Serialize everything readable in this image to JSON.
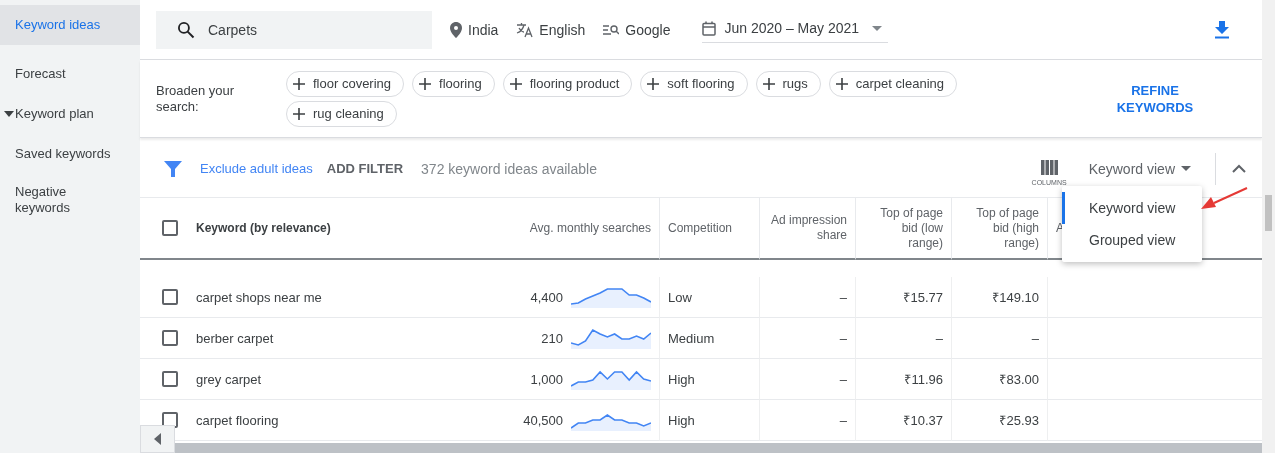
{
  "sidebar": {
    "items": [
      {
        "label": "Keyword ideas",
        "kind": "link",
        "selected": true
      },
      {
        "label": "Forecast",
        "kind": "link",
        "selected": false
      },
      {
        "label": "Keyword plan",
        "kind": "group",
        "selected": false,
        "expanded": true
      },
      {
        "label": "Saved keywords",
        "kind": "link",
        "selected": false
      },
      {
        "label": "Negative keywords",
        "kind": "link",
        "selected": false
      }
    ]
  },
  "top_bar": {
    "search": {
      "value": "Carpets"
    },
    "location": "India",
    "language": "English",
    "network": "Google",
    "date_range": "Jun 2020 – May 2021"
  },
  "broaden": {
    "label": "Broaden your search:",
    "chips": [
      "floor covering",
      "flooring",
      "flooring product",
      "soft flooring",
      "rugs",
      "carpet cleaning",
      "rug cleaning"
    ],
    "refine_button": "REFINE KEYWORDS"
  },
  "filter_bar": {
    "exclude_link": "Exclude adult ideas",
    "add_filter": "ADD FILTER",
    "count": "372 keyword ideas available",
    "columns_button": "COLUMNS",
    "view_select": "Keyword view"
  },
  "view_menu": {
    "items": [
      {
        "label": "Keyword view",
        "selected": true
      },
      {
        "label": "Grouped view",
        "selected": false
      }
    ]
  },
  "table": {
    "select_all": {
      "checked": false
    },
    "columns": [
      "Keyword (by relevance)",
      "Avg. monthly searches",
      "Competition",
      "Ad impression share",
      "Top of page bid (low range)",
      "Top of page bid (high range)",
      "A"
    ],
    "rows": [
      {
        "checked": false,
        "keyword": "carpet shops near me",
        "searches": "4,400",
        "competition": "Low",
        "impression_share": "–",
        "bid_low": "₹15.77",
        "bid_high": "₹149.10"
      },
      {
        "checked": false,
        "keyword": "berber carpet",
        "searches": "210",
        "competition": "Medium",
        "impression_share": "–",
        "bid_low": "–",
        "bid_high": "–"
      },
      {
        "checked": false,
        "keyword": "grey carpet",
        "searches": "1,000",
        "competition": "High",
        "impression_share": "–",
        "bid_low": "₹11.96",
        "bid_high": "₹83.00"
      },
      {
        "checked": false,
        "keyword": "carpet flooring",
        "searches": "40,500",
        "competition": "High",
        "impression_share": "–",
        "bid_low": "₹10.37",
        "bid_high": "₹25.93"
      }
    ]
  }
}
